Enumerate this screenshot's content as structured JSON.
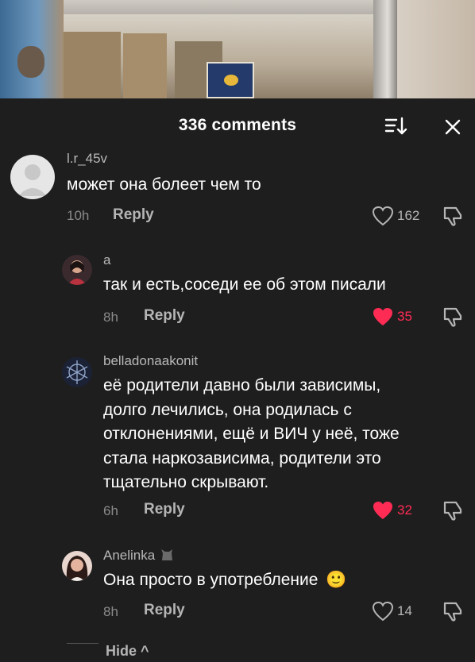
{
  "header": {
    "title": "336 comments"
  },
  "comments": [
    {
      "username": "l.r_45v",
      "text": "может она болеет чем то",
      "time": "10h",
      "reply_label": "Reply",
      "likes": "162",
      "liked": false
    },
    {
      "username": "a",
      "text": "так и есть,соседи ее об этом писали",
      "time": "8h",
      "reply_label": "Reply",
      "likes": "35",
      "liked": true
    },
    {
      "username": "belladonaakonit",
      "text_lines": [
        "её родители давно были зависимы,",
        "долго лечились, она родилась с",
        "отклонениями, ещё и ВИЧ у неё, тоже",
        "стала наркозависима, родители это",
        "тщательно скрывают."
      ],
      "time": "6h",
      "reply_label": "Reply",
      "likes": "32",
      "liked": true
    },
    {
      "username": "Anelinka",
      "text": "Она просто в употребление",
      "emoji": "🙂",
      "time": "8h",
      "reply_label": "Reply",
      "likes": "14",
      "liked": false
    }
  ],
  "footer": {
    "hide_label": "Hide ^"
  },
  "colors": {
    "background": "#1e1e1e",
    "like_red": "#fe2c55",
    "muted": "#8a8a8a"
  },
  "icons": [
    "sort-icon",
    "close-icon",
    "heart-icon",
    "dislike-icon",
    "cat-icon"
  ]
}
